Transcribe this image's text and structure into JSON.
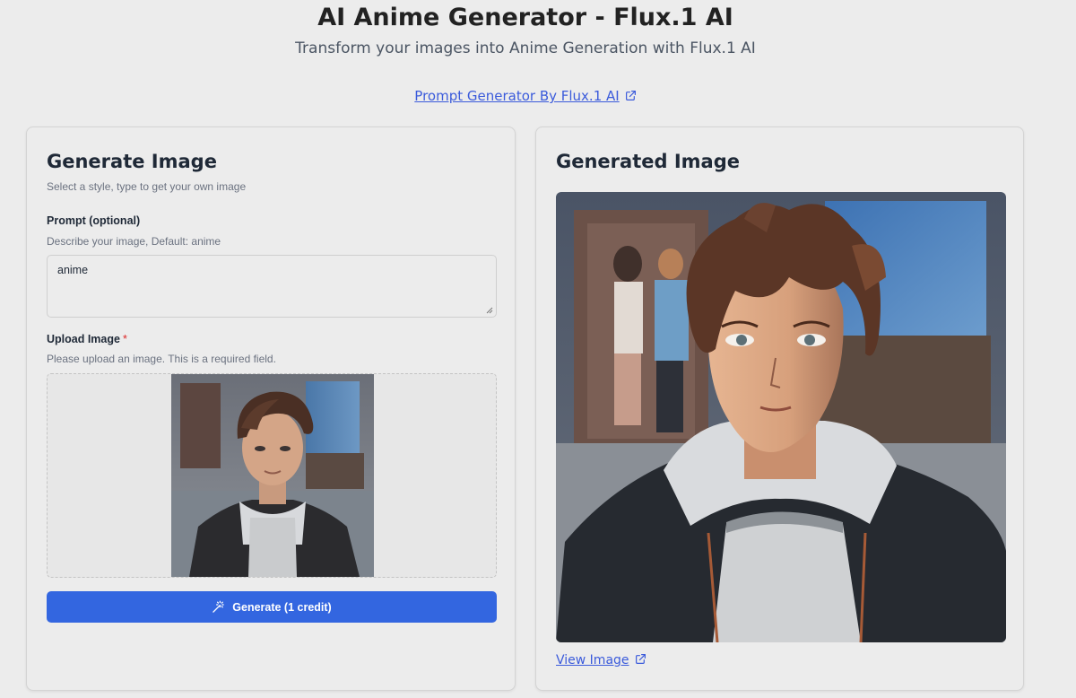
{
  "header": {
    "title": "AI Anime Generator - Flux.1 AI",
    "subtitle": "Transform your images into Anime Generation with Flux.1 AI",
    "prompt_link": "Prompt Generator By Flux.1 AI",
    "link_icon": "external-link-icon"
  },
  "generate_card": {
    "title": "Generate Image",
    "description": "Select a style, type to get your own image",
    "prompt": {
      "label": "Prompt (optional)",
      "hint": "Describe your image, Default: anime",
      "value": "anime"
    },
    "upload": {
      "label": "Upload Image",
      "required_mark": "*",
      "hint": "Please upload an image. This is a required field."
    },
    "generate_button": "Generate (1 credit)",
    "button_icon": "magic-wand-icon"
  },
  "result_card": {
    "title": "Generated Image",
    "view_link": "View Image",
    "link_icon": "external-link-icon"
  },
  "colors": {
    "accent": "#3366e0",
    "link": "#3b5bdb",
    "background": "#ececec",
    "required": "#dc2626"
  }
}
